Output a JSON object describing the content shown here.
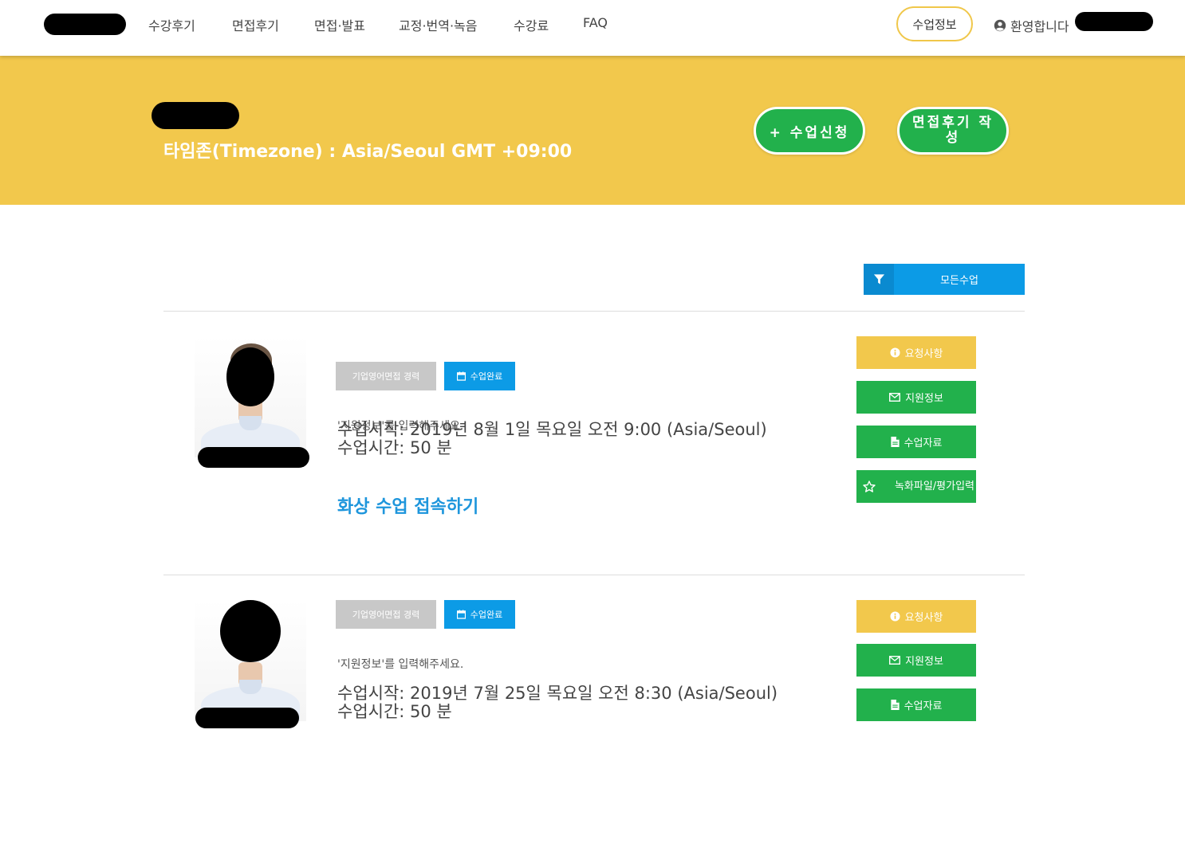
{
  "nav": {
    "items": [
      "수강후기",
      "면접후기",
      "면접·발표",
      "교정·번역·녹음",
      "수강료",
      "FAQ"
    ],
    "class_info_button": "수업정보",
    "welcome_text": "환영합니다"
  },
  "banner": {
    "timezone_text": "타임존(Timezone) : Asia/Seoul GMT  +09:00",
    "apply_button": "+ 수업신청",
    "review_button": "면접후기 작성"
  },
  "filter": {
    "label": "모든수업"
  },
  "lessons": [
    {
      "category_tag": "기업영어면접   경력",
      "status_tag": "수업완료",
      "prompt": "'지원정보'를 입력해주세요.",
      "start": "수업시작: 2019년 8월 1일 목요일 오전 9:00 (Asia/Seoul)",
      "duration": "수업시간: 50 분",
      "video_link": "화상 수업 접속하기",
      "actions": {
        "request": "요청사항",
        "application_info": "지원정보",
        "materials": "수업자료",
        "recording": "녹화파일/평가입력"
      }
    },
    {
      "category_tag": "기업영어면접   경력",
      "status_tag": "수업완료",
      "prompt": "'지원정보'를 입력해주세요.",
      "start": "수업시작: 2019년 7월 25일 목요일 오전 8:30 (Asia/Seoul)",
      "duration": "수업시간: 50 분",
      "actions": {
        "request": "요청사항",
        "application_info": "지원정보",
        "materials": "수업자료"
      }
    }
  ],
  "colors": {
    "banner_yellow": "#f2c84c",
    "primary_green": "#22b14c",
    "primary_blue": "#0c9be6",
    "tag_gray": "#c8c8c8"
  },
  "icons": [
    "user-circle-icon",
    "filter-icon",
    "calendar-icon",
    "info-icon",
    "envelope-icon",
    "file-icon",
    "star-icon"
  ]
}
